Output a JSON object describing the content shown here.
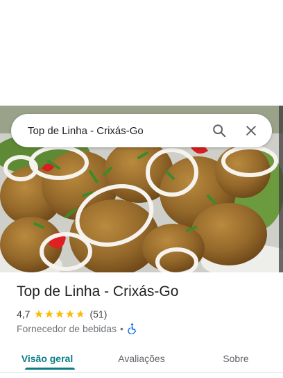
{
  "place": {
    "search_query": "Top de Linha - Crixás-Go",
    "name": "Top de Linha - Crixás-Go",
    "rating": "4,7",
    "rating_value": 4.7,
    "reviews_count": "(51)",
    "category": "Fornecedor de bebidas",
    "separator": "•"
  },
  "icons": {
    "search": "search-icon",
    "close": "close-icon",
    "star": "star-icon",
    "accessibility": "wheelchair-icon"
  },
  "tabs": [
    {
      "label": "Visão geral",
      "active": true
    },
    {
      "label": "Avaliações",
      "active": false
    },
    {
      "label": "Sobre",
      "active": false
    }
  ],
  "colors": {
    "accent": "#0b7c86",
    "star": "#fbbc04",
    "accessibility": "#1a73e8"
  }
}
